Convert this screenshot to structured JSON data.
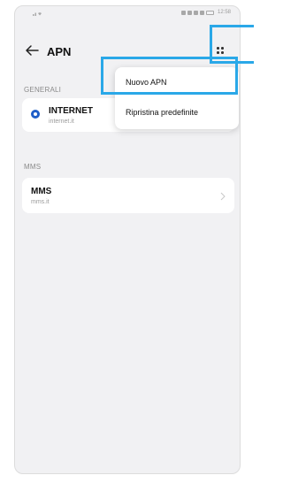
{
  "status_bar": {
    "time": "12:58",
    "signal_icon": "signal-wifi-icon",
    "icons": [
      "nfc-icon",
      "vibrate-icon",
      "bluetooth-icon",
      "alarm-icon",
      "battery-icon"
    ]
  },
  "app_bar": {
    "title": "APN",
    "back_icon": "arrow-left-icon",
    "more_icon": "more-dots-icon"
  },
  "sections": {
    "general_label": "GENERALI",
    "mms_label": "MMS"
  },
  "apn_items": [
    {
      "name": "INTERNET",
      "value": "internet.it",
      "selected": true
    },
    {
      "name": "MMS",
      "value": "mms.it",
      "selected": false
    }
  ],
  "menu": {
    "items": [
      "Nuovo APN",
      "Ripristina predefinite"
    ]
  },
  "colors": {
    "accent": "#1f5ec8",
    "highlight": "#2aa8e8",
    "background": "#f1f1f3"
  }
}
